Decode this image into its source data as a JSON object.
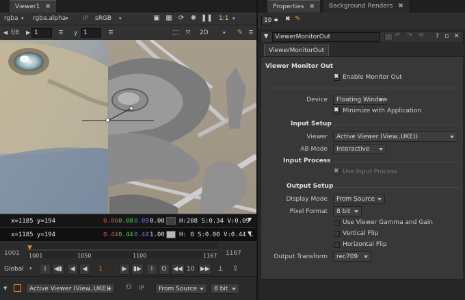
{
  "viewer": {
    "tab_label": "Viewer1",
    "toolbar1": {
      "channels": "rgba",
      "alpha": "rgba.alpha",
      "ip": "IP",
      "colorspace": "sRGB",
      "zoom": "1:1"
    },
    "toolbar2": {
      "fstop": "f/8",
      "frame": "1",
      "y_label": "y",
      "y_value": "1",
      "view_mode": "2D"
    },
    "readout1": {
      "coords": "x=1185 y=194",
      "r": "0.06",
      "g": "0.08",
      "b": "0.09",
      "a": "0.00",
      "hsv": "H:208 S:0.34 V:0.09",
      "swatch_color": "#3a4047"
    },
    "readout2": {
      "coords": "x=1185 y=194",
      "r": "0.44",
      "g": "0.44",
      "b": "0.44",
      "a": "1.00",
      "hsv": "H:  0 S:0.00 V:0.44  L",
      "swatch_color": "#b8b8b8"
    },
    "timeline": {
      "start": "1001",
      "end": "1167",
      "marker": "1001",
      "ticks": [
        "1001",
        "1050",
        "1100",
        "1167"
      ]
    },
    "playback": {
      "mode": "Global",
      "frame": "1",
      "step": "10"
    },
    "bottom_bar": {
      "input_viewer": "Active Viewer (View..UKE))",
      "ip": "IP",
      "display_mode": "From Source",
      "pixel_format": "8 bit"
    },
    "colors": {
      "red": "#e05050",
      "green": "#50d050",
      "blue": "#5a6aff",
      "orange": "#e08a20"
    }
  },
  "properties": {
    "tabs": [
      {
        "label": "Properties"
      },
      {
        "label": "Background Renders"
      }
    ],
    "max_panels": "10",
    "node_name": "ViewerMonitorOut",
    "node_tab": "ViewerMonitorOut",
    "title": "Viewer Monitor Out",
    "enable_monitor_out": "Enable Monitor Out",
    "device_label": "Device",
    "device_value": "Floating Window",
    "minimize_label": "Minimize with Application",
    "input_setup": "Input Setup",
    "viewer_label": "Viewer",
    "viewer_value": "Active Viewer (View..UKE))",
    "ab_mode_label": "AB Mode",
    "ab_mode_value": "Interactive",
    "input_process": "Input Process",
    "use_input_process": "Use Input Process",
    "output_setup": "Output Setup",
    "display_mode_label": "Display Mode",
    "display_mode_value": "From Source",
    "pixel_format_label": "Pixel Format",
    "pixel_format_value": "8 bit",
    "gamma_gain": "Use Viewer Gamma and Gain",
    "vertical_flip": "Vertical Flip",
    "horizontal_flip": "Horizontal Flip",
    "output_transform_label": "Output Transform",
    "output_transform_value": "rec709"
  }
}
